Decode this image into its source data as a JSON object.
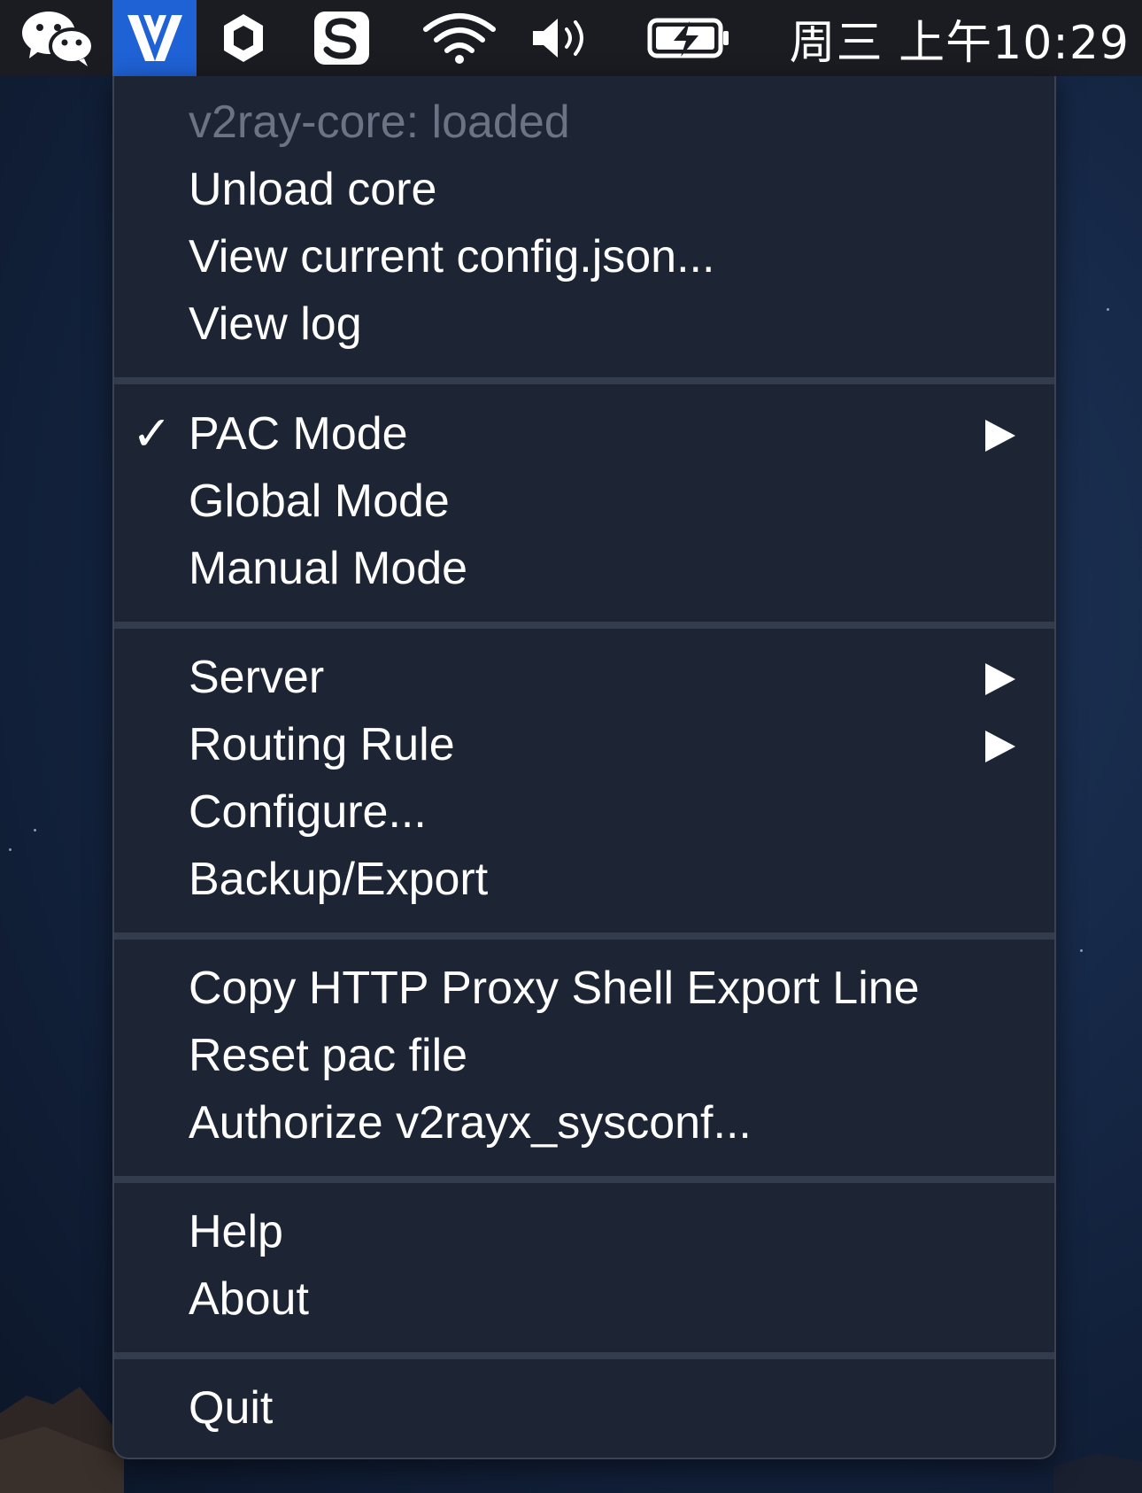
{
  "menubar": {
    "clock": "周三 上午10:29",
    "icons": [
      "wechat-icon",
      "v2rayx-icon",
      "hexagon-app-icon",
      "s-app-icon",
      "wifi-icon",
      "volume-icon",
      "battery-charging-icon"
    ]
  },
  "menu": {
    "status": "v2ray-core: loaded",
    "unload_core": "Unload core",
    "view_config": "View current config.json...",
    "view_log": "View log",
    "pac_mode": "PAC Mode",
    "pac_mode_checked": true,
    "check_mark": "✓",
    "global_mode": "Global Mode",
    "manual_mode": "Manual Mode",
    "server": "Server",
    "routing_rule": "Routing Rule",
    "configure": "Configure...",
    "backup_export": "Backup/Export",
    "copy_proxy": "Copy HTTP Proxy Shell Export Line",
    "reset_pac": "Reset pac file",
    "authorize": "Authorize v2rayx_sysconf...",
    "help": "Help",
    "about": "About",
    "quit": "Quit"
  },
  "colors": {
    "menubar_bg": "#1a1c22",
    "active_icon_bg": "#1f62d6",
    "menu_bg": "#1d2535",
    "separator": "#333c4c",
    "disabled_text": "#6b7384"
  }
}
